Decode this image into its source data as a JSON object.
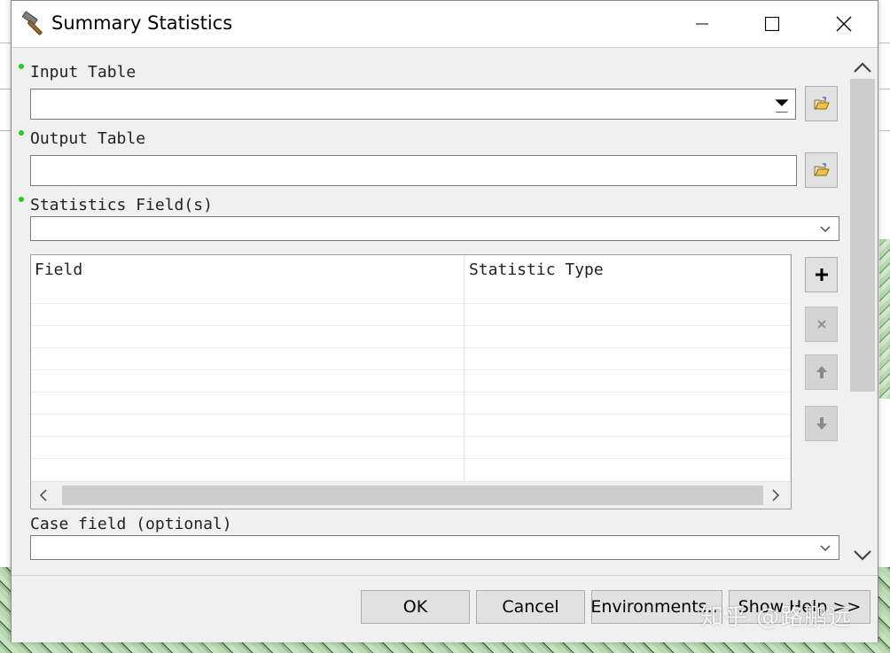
{
  "window": {
    "title": "Summary Statistics",
    "icon": "hammer-icon"
  },
  "form": {
    "input_table": {
      "label": "Input Table",
      "value": "",
      "required": true
    },
    "output_table": {
      "label": "Output Table",
      "value": "",
      "required": true
    },
    "statistics_fields": {
      "label": "Statistics Field(s)",
      "value": "",
      "required": true
    },
    "grid": {
      "columns": [
        "Field",
        "Statistic Type"
      ],
      "rows": []
    },
    "case_field": {
      "label": "Case field (optional)",
      "value": ""
    }
  },
  "buttons": {
    "ok": "OK",
    "cancel": "Cancel",
    "environments": "Environments...",
    "show_help": "Show Help >>"
  },
  "watermark": "知乎 @路鹏远",
  "colors": {
    "required_dot": "#22cc22",
    "dialog_bg": "#f0f0f0"
  }
}
